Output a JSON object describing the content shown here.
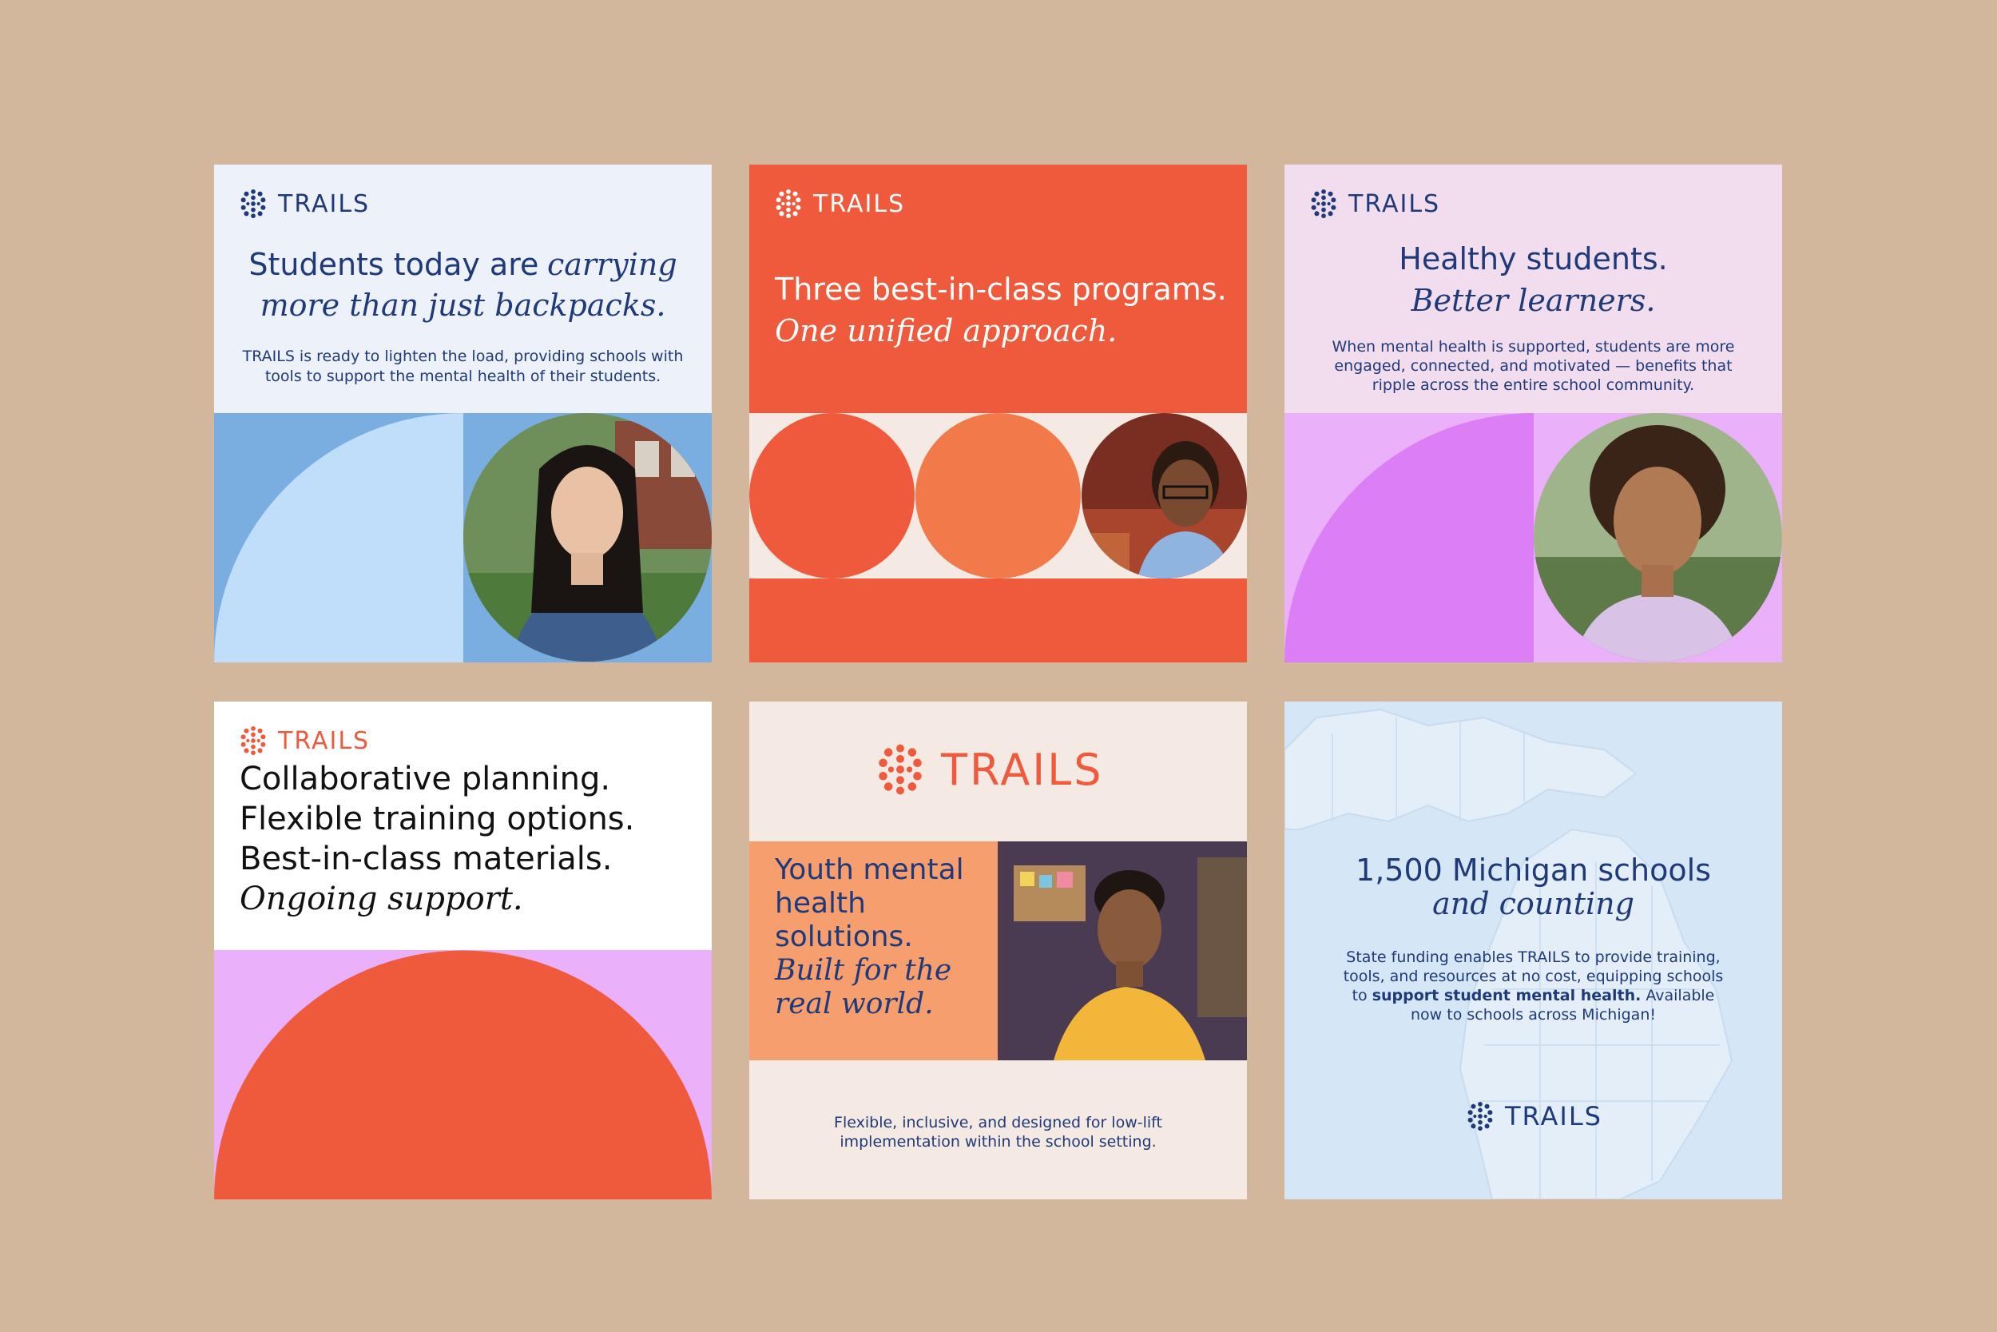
{
  "brand": {
    "name": "TRAILS",
    "colors": {
      "navy": "#1F3A7A",
      "coral": "#EF5A3D",
      "orange": "#F27A4A",
      "peach": "#F79E6E",
      "lavender": "#E88CFB",
      "light_blue": "#C0DDFA",
      "mid_blue": "#7AAEE0",
      "cream": "#F5E9E3",
      "canvas_tan": "#D3B79D"
    }
  },
  "cards": {
    "card1": {
      "logo_text": "TRAILS",
      "headline_plain": "Students today are",
      "headline_italic_1": "carrying",
      "headline_italic_2": "more than just backpacks.",
      "body": "TRAILS is ready to lighten the load, providing schools with tools to support the mental health of their students.",
      "photo_icon": "student-portrait-photo"
    },
    "card2": {
      "logo_text": "TRAILS",
      "headline_plain": "Three best-in-class programs.",
      "headline_italic": "One unified approach.",
      "photo_icon": "student-portrait-photo"
    },
    "card3": {
      "logo_text": "TRAILS",
      "headline_plain": "Healthy students.",
      "headline_italic": "Better learners.",
      "body": "When mental health is supported, students are more engaged, connected, and motivated — benefits that ripple across the entire school community.",
      "photo_icon": "student-portrait-photo"
    },
    "card4": {
      "logo_text": "TRAILS",
      "line1": "Collaborative planning.",
      "line2": "Flexible training options.",
      "line3": "Best-in-class materials.",
      "line4_italic": "Ongoing support."
    },
    "card5": {
      "logo_text": "TRAILS",
      "headline_plain": "Youth mental health solutions.",
      "headline_italic": "Built for the real world.",
      "body": "Flexible, inclusive, and designed for low-lift implementation within the school setting.",
      "photo_icon": "educator-portrait-photo"
    },
    "card6": {
      "logo_text": "TRAILS",
      "headline_plain": "1,500 Michigan schools",
      "headline_italic": "and counting",
      "body_pre": "State funding enables TRAILS to provide training, tools, and resources at no cost, equipping schools to",
      "body_bold": "support student mental health.",
      "body_post": "Available now to schools across Michigan!",
      "map_icon": "michigan-map"
    }
  }
}
